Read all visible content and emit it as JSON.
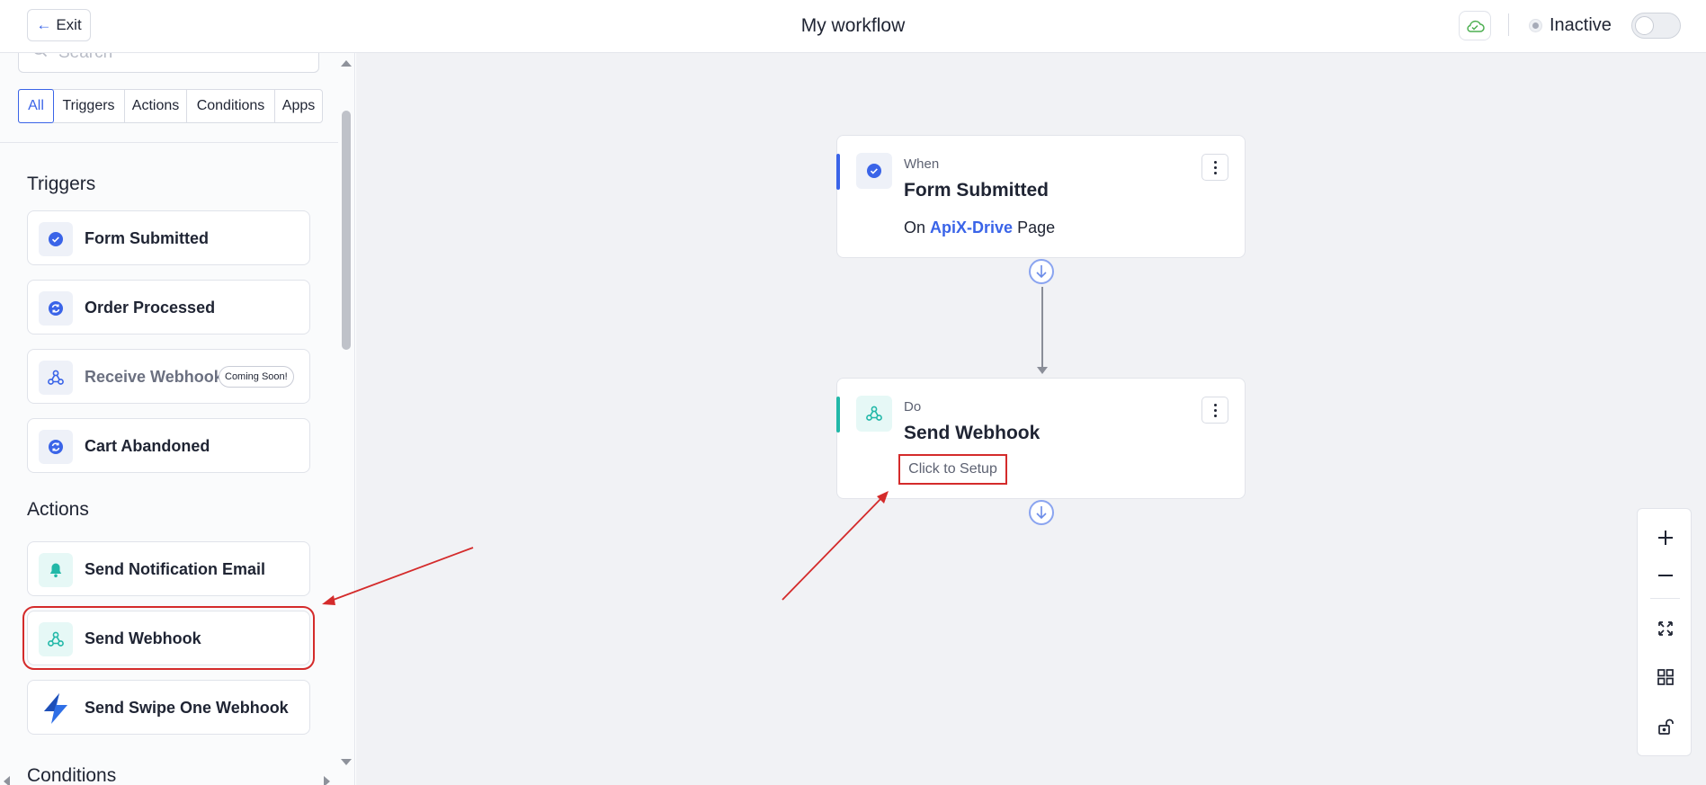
{
  "header": {
    "exit_label": "Exit",
    "title": "My workflow",
    "status_label": "Inactive",
    "status_toggle_on": false
  },
  "sidebar": {
    "search_placeholder": "Search",
    "filter_tabs": [
      {
        "label": "All",
        "active": true
      },
      {
        "label": "Triggers",
        "active": false
      },
      {
        "label": "Actions",
        "active": false
      },
      {
        "label": "Conditions",
        "active": false
      },
      {
        "label": "Apps",
        "active": false
      }
    ],
    "triggers_title": "Triggers",
    "triggers": [
      {
        "label": "Form Submitted",
        "icon": "check-circle-icon"
      },
      {
        "label": "Order Processed",
        "icon": "sync-icon"
      },
      {
        "label": "Receive Webhook",
        "icon": "webhook-icon",
        "badge": "Coming Soon!"
      },
      {
        "label": "Cart Abandoned",
        "icon": "sync-icon"
      }
    ],
    "actions_title": "Actions",
    "actions": [
      {
        "label": "Send Notification Email",
        "icon": "bell-icon"
      },
      {
        "label": "Send Webhook",
        "icon": "webhook-icon"
      },
      {
        "label": "Send Swipe One Webhook",
        "icon": "lightning-icon"
      }
    ],
    "next_section_partial": "Conditions"
  },
  "canvas": {
    "trigger_node": {
      "kind": "When",
      "title": "Form Submitted",
      "sub_prefix": "On",
      "sub_link": "ApiX-Drive",
      "sub_suffix": "Page"
    },
    "action_node": {
      "kind": "Do",
      "title": "Send Webhook",
      "setup_label": "Click to Setup"
    }
  },
  "colors": {
    "accent_blue": "#3a64e8",
    "accent_teal": "#22b8a8",
    "annotation_red": "#d42b2b"
  }
}
